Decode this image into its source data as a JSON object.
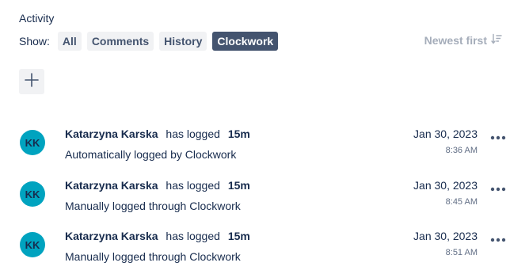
{
  "header": {
    "title": "Activity"
  },
  "filters": {
    "show_label": "Show:",
    "items": [
      {
        "label": "All",
        "active": false
      },
      {
        "label": "Comments",
        "active": false
      },
      {
        "label": "History",
        "active": false
      },
      {
        "label": "Clockwork",
        "active": true
      }
    ]
  },
  "sort": {
    "label": "Newest first",
    "icon": "sort-descending-icon"
  },
  "add_button": {
    "icon": "plus-icon"
  },
  "entries": [
    {
      "initials": "KK",
      "author": "Katarzyna Karska",
      "verb": "has logged",
      "duration": "15m",
      "description": "Automatically logged by Clockwork",
      "date": "Jan 30, 2023",
      "time": "8:36 AM"
    },
    {
      "initials": "KK",
      "author": "Katarzyna Karska",
      "verb": "has logged",
      "duration": "15m",
      "description": "Manually logged through Clockwork",
      "date": "Jan 30, 2023",
      "time": "8:45 AM"
    },
    {
      "initials": "KK",
      "author": "Katarzyna Karska",
      "verb": "has logged",
      "duration": "15m",
      "description": "Manually logged through Clockwork",
      "date": "Jan 30, 2023",
      "time": "8:51 AM"
    }
  ],
  "colors": {
    "avatar": "#00a3bf",
    "chip_active": "#44546f",
    "chip_bg": "#f1f2f4",
    "muted": "#a5adba"
  }
}
